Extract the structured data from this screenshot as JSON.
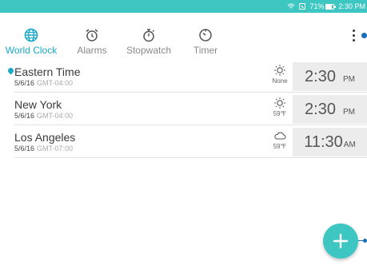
{
  "status_bar": {
    "battery_text": "71%",
    "time": "2:30 PM",
    "icons": [
      "wifi-icon",
      "no-sim-icon",
      "battery-icon"
    ]
  },
  "tabs": [
    {
      "label": "World Clock",
      "icon": "globe-icon",
      "active": true
    },
    {
      "label": "Alarms",
      "icon": "alarm-clock-icon",
      "active": false
    },
    {
      "label": "Stopwatch",
      "icon": "stopwatch-icon",
      "active": false
    },
    {
      "label": "Timer",
      "icon": "timer-icon",
      "active": false
    }
  ],
  "menu": {
    "icon": "more-vert-icon"
  },
  "clocks": [
    {
      "city": "Eastern Time",
      "current_location": true,
      "date": "5/6/16",
      "gmt": "GMT-04:00",
      "weather_icon": "sun-icon",
      "weather_text": "None",
      "time": "2:30",
      "ampm": "PM"
    },
    {
      "city": "New York",
      "current_location": false,
      "date": "5/6/16",
      "gmt": "GMT-04:00",
      "weather_icon": "sun-icon",
      "weather_text": "59℉",
      "time": "2:30",
      "ampm": "PM"
    },
    {
      "city": "Los Angeles",
      "current_location": false,
      "date": "5/6/16",
      "gmt": "GMT-07:00",
      "weather_icon": "cloud-icon",
      "weather_text": "59℉",
      "time": "11:30",
      "ampm": "AM"
    }
  ],
  "fab": {
    "icon": "plus-icon"
  },
  "colors": {
    "accent": "#3ec7c2",
    "active_tab": "#1aa9c9",
    "time_box": "#ececec"
  }
}
